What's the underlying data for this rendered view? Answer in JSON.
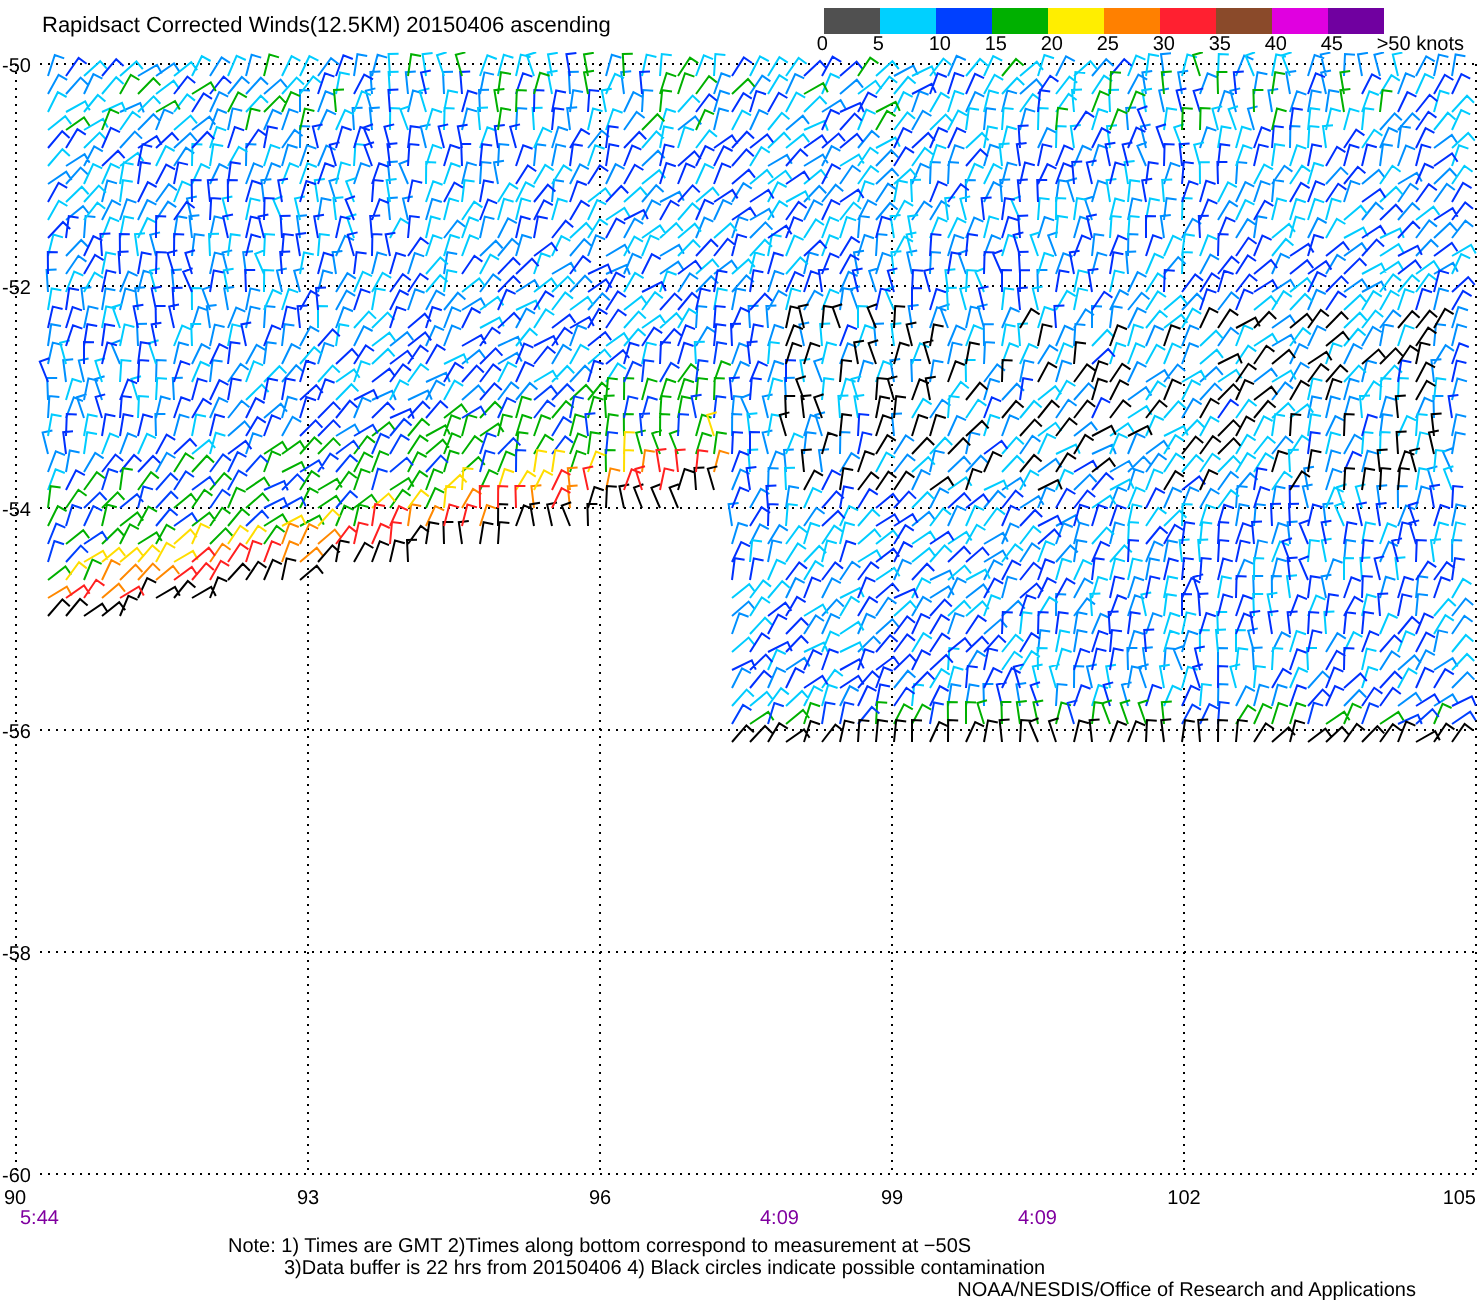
{
  "title": "Rapidsact Corrected Winds(12.5KM) 20150406 ascending",
  "legend": {
    "bins": [
      {
        "label": "0",
        "color": "#505050"
      },
      {
        "label": "5",
        "color": "#00d0ff"
      },
      {
        "label": "10",
        "color": "#0040ff"
      },
      {
        "label": "15",
        "color": "#00b000"
      },
      {
        "label": "20",
        "color": "#ffee00"
      },
      {
        "label": "25",
        "color": "#ff8000"
      },
      {
        "label": "30",
        "color": "#ff2030"
      },
      {
        "label": "35",
        "color": "#8a4a2a"
      },
      {
        "label": "40",
        "color": "#e000e0"
      },
      {
        "label": "45",
        "color": "#7000a0"
      }
    ],
    "end_label": ">50 knots"
  },
  "y_ticks": [
    "-50",
    "-52",
    "-54",
    "-56",
    "-58",
    "-60"
  ],
  "x_ticks": [
    "90",
    "93",
    "96",
    "99",
    "102",
    "105"
  ],
  "times": [
    {
      "text": "5:44",
      "kind": "start"
    },
    {
      "text": "4:09",
      "kind": "left"
    },
    {
      "text": "4:09",
      "kind": "right"
    }
  ],
  "notes": [
    "Note: 1) Times are GMT 2)Times along bottom correspond to measurement at −50S",
    "3)Data buffer is 22 hrs from 20150406 4) Black circles indicate possible contamination"
  ],
  "credit": "NOAA/NESDIS/Office of Research and Applications"
}
